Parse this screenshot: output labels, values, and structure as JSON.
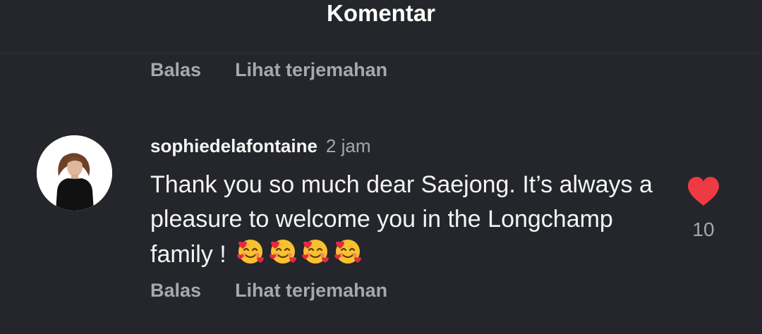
{
  "header": {
    "title": "Komentar"
  },
  "previous_comment": {
    "reply_label": "Balas",
    "translate_label": "Lihat terjemahan"
  },
  "comment": {
    "username": "sophiedelafontaine",
    "time": "2 jam",
    "text": "Thank you so much dear Saejong. It’s always a pleasure to welcome you in the Longchamp family !",
    "emoji_icon": "smiling-face-with-hearts-icon",
    "emoji_count": 4,
    "like_icon": "heart-icon",
    "like_color": "#ee3a43",
    "like_count": "10",
    "reply_label": "Balas",
    "translate_label": "Lihat terjemahan"
  }
}
